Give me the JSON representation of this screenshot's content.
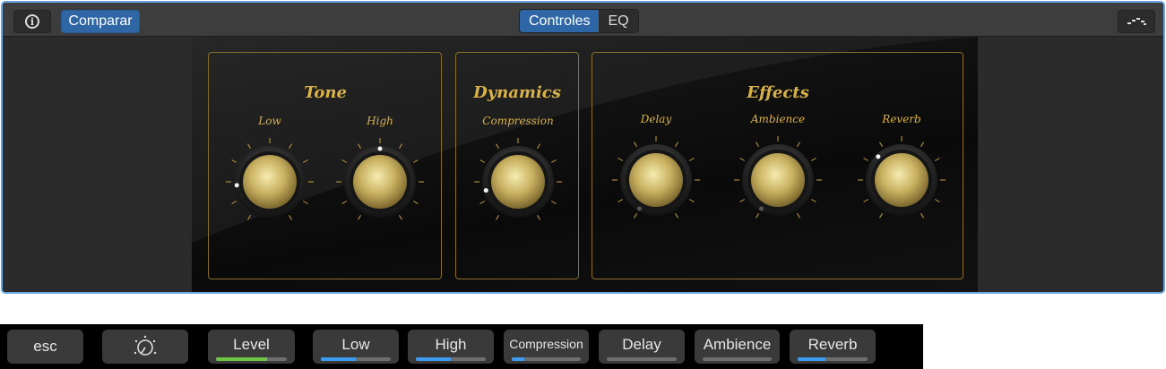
{
  "toolbar": {
    "info_icon": "info-icon",
    "compare_label": "Comparar",
    "tabs": [
      {
        "label": "Controles",
        "active": true
      },
      {
        "label": "EQ",
        "active": false
      }
    ],
    "view_icon": "view-toggle-icon"
  },
  "plugin": {
    "groups": [
      {
        "title": "Tone",
        "knobs": [
          {
            "label": "Low",
            "value": 0.18
          },
          {
            "label": "High",
            "value": 0.5
          }
        ]
      },
      {
        "title": "Dynamics",
        "knobs": [
          {
            "label": "Compression",
            "value": 0.15
          }
        ]
      },
      {
        "title": "Effects",
        "knobs": [
          {
            "label": "Delay",
            "value": 0.0
          },
          {
            "label": "Ambience",
            "value": 0.0
          },
          {
            "label": "Reverb",
            "value": 0.35
          }
        ]
      }
    ],
    "colors": {
      "gold": "#d9b24a",
      "frame": "#8a6f2c"
    }
  },
  "touchbar": {
    "esc": "esc",
    "knob_icon": "knob-icon",
    "controls": [
      {
        "label": "Level",
        "value": 0.72,
        "color": "#6cc644"
      },
      {
        "label": "Low",
        "value": 0.5,
        "color": "#3d9cf0"
      },
      {
        "label": "High",
        "value": 0.5,
        "color": "#3d9cf0"
      },
      {
        "label": "Compression",
        "value": 0.18,
        "color": "#3d9cf0"
      },
      {
        "label": "Delay",
        "value": 0.0,
        "color": "#3d9cf0"
      },
      {
        "label": "Ambience",
        "value": 0.0,
        "color": "#3d9cf0"
      },
      {
        "label": "Reverb",
        "value": 0.4,
        "color": "#3d9cf0"
      }
    ]
  }
}
